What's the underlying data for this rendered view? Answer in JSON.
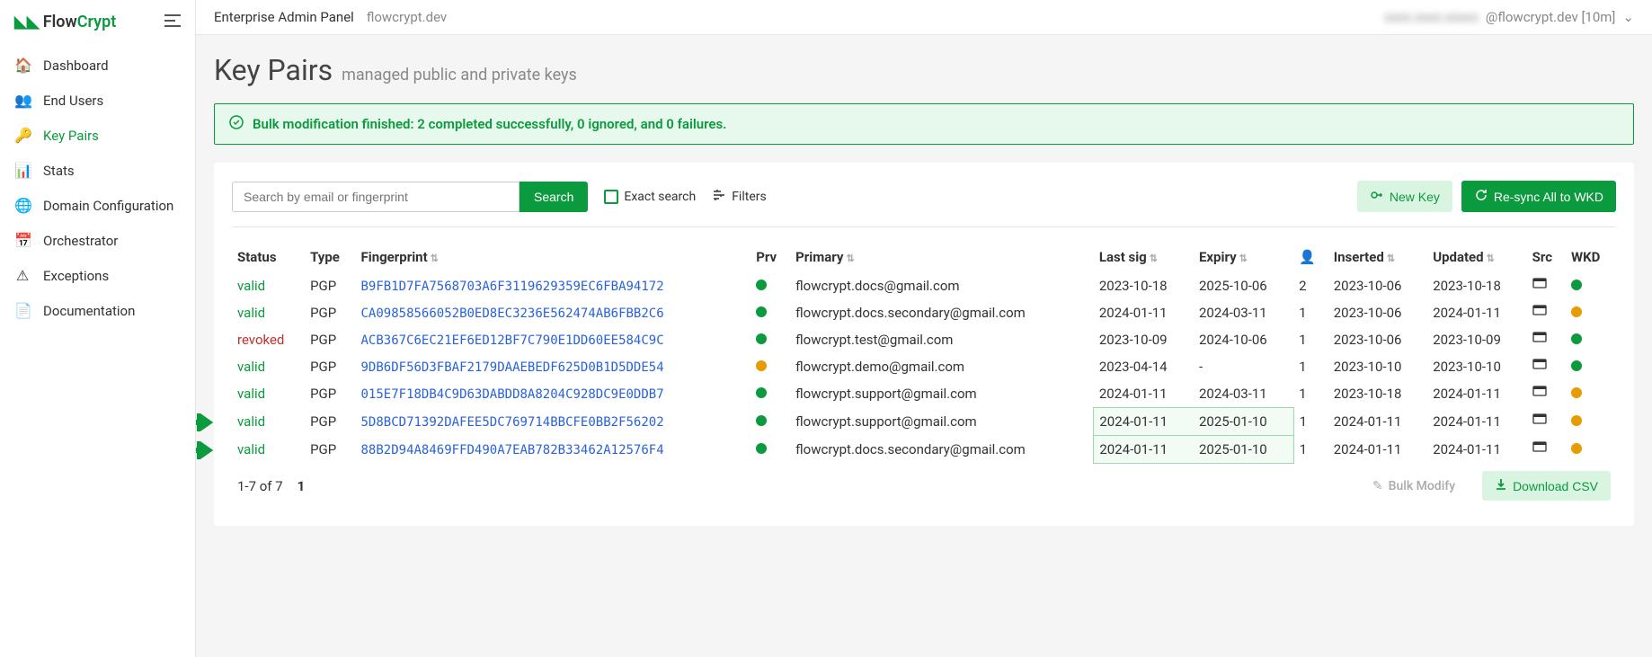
{
  "logo": {
    "flow": "Flow",
    "crypt": "Crypt"
  },
  "sidebar": {
    "items": [
      {
        "icon": "🏠",
        "label": "Dashboard",
        "name": "sidebar-item-dashboard"
      },
      {
        "icon": "👥",
        "label": "End Users",
        "name": "sidebar-item-end-users"
      },
      {
        "icon": "🔑",
        "label": "Key Pairs",
        "name": "sidebar-item-key-pairs",
        "active": true
      },
      {
        "icon": "📊",
        "label": "Stats",
        "name": "sidebar-item-stats"
      },
      {
        "icon": "🌐",
        "label": "Domain Configuration",
        "name": "sidebar-item-domain-configuration"
      },
      {
        "icon": "📅",
        "label": "Orchestrator",
        "name": "sidebar-item-orchestrator"
      },
      {
        "icon": "⚠",
        "label": "Exceptions",
        "name": "sidebar-item-exceptions"
      },
      {
        "icon": "📄",
        "label": "Documentation",
        "name": "sidebar-item-documentation"
      }
    ]
  },
  "topbar": {
    "title": "Enterprise Admin Panel",
    "domain": "flowcrypt.dev",
    "user_suffix": "@flowcrypt.dev [10m]"
  },
  "page": {
    "title": "Key Pairs",
    "subtitle": "managed public and private keys"
  },
  "alert": {
    "icon": "✓",
    "text": "Bulk modification finished: 2 completed successfully, 0 ignored, and 0 failures."
  },
  "toolbar": {
    "search_placeholder": "Search by email or fingerprint",
    "search_button": "Search",
    "exact_search": "Exact search",
    "filters": "Filters",
    "new_key": "New Key",
    "resync": "Re-sync All to WKD"
  },
  "columns": [
    "Status",
    "Type",
    "Fingerprint",
    "Prv",
    "Primary",
    "Last sig",
    "Expiry",
    "",
    "Inserted",
    "Updated",
    "Src",
    "WKD"
  ],
  "rows": [
    {
      "status": "valid",
      "status_class": "status-valid",
      "type": "PGP",
      "fingerprint": "B9FB1D7FA7568703A6F3119629359EC6FBA94172",
      "prv": "green",
      "primary": "flowcrypt.docs@gmail.com",
      "last_sig": "2023-10-18",
      "expiry": "2025-10-06",
      "users": "2",
      "inserted": "2023-10-06",
      "updated": "2023-10-18",
      "wkd": "green",
      "highlight": false,
      "arrow": false
    },
    {
      "status": "valid",
      "status_class": "status-valid",
      "type": "PGP",
      "fingerprint": "CA09858566052B0ED8EC3236E562474AB6FBB2C6",
      "prv": "green",
      "primary": "flowcrypt.docs.secondary@gmail.com",
      "last_sig": "2024-01-11",
      "expiry": "2024-03-11",
      "users": "1",
      "inserted": "2023-10-06",
      "updated": "2024-01-11",
      "wkd": "orange",
      "highlight": false,
      "arrow": false
    },
    {
      "status": "revoked",
      "status_class": "status-revoked",
      "type": "PGP",
      "fingerprint": "ACB367C6EC21EF6ED12BF7C790E1DD60EE584C9C",
      "prv": "green",
      "primary": "flowcrypt.test@gmail.com",
      "last_sig": "2023-10-09",
      "expiry": "2024-10-06",
      "users": "1",
      "inserted": "2023-10-06",
      "updated": "2023-10-09",
      "wkd": "green",
      "highlight": false,
      "arrow": false
    },
    {
      "status": "valid",
      "status_class": "status-valid",
      "type": "PGP",
      "fingerprint": "9DB6DF56D3FBAF2179DAAEBEDF625D0B1D5DDE54",
      "prv": "orange",
      "primary": "flowcrypt.demo@gmail.com",
      "last_sig": "2023-04-14",
      "expiry": "-",
      "users": "1",
      "inserted": "2023-10-10",
      "updated": "2023-10-10",
      "wkd": "green",
      "highlight": false,
      "arrow": false
    },
    {
      "status": "valid",
      "status_class": "status-valid",
      "type": "PGP",
      "fingerprint": "015E7F18DB4C9D63DABDD8A8204C928DC9E0DDB7",
      "prv": "green",
      "primary": "flowcrypt.support@gmail.com",
      "last_sig": "2024-01-11",
      "expiry": "2024-03-11",
      "users": "1",
      "inserted": "2023-10-18",
      "updated": "2024-01-11",
      "wkd": "orange",
      "highlight": false,
      "arrow": false
    },
    {
      "status": "valid",
      "status_class": "status-valid",
      "type": "PGP",
      "fingerprint": "5D8BCD71392DAFEE5DC769714BBCFE0BB2F56202",
      "prv": "green",
      "primary": "flowcrypt.support@gmail.com",
      "last_sig": "2024-01-11",
      "expiry": "2025-01-10",
      "users": "1",
      "inserted": "2024-01-11",
      "updated": "2024-01-11",
      "wkd": "orange",
      "highlight": true,
      "arrow": true
    },
    {
      "status": "valid",
      "status_class": "status-valid",
      "type": "PGP",
      "fingerprint": "88B2D94A8469FFD490A7EAB782B33462A12576F4",
      "prv": "green",
      "primary": "flowcrypt.docs.secondary@gmail.com",
      "last_sig": "2024-01-11",
      "expiry": "2025-01-10",
      "users": "1",
      "inserted": "2024-01-11",
      "updated": "2024-01-11",
      "wkd": "orange",
      "highlight": true,
      "arrow": true
    }
  ],
  "footer": {
    "range": "1-7 of 7",
    "page": "1",
    "bulk_modify": "Bulk Modify",
    "download_csv": "Download CSV"
  }
}
